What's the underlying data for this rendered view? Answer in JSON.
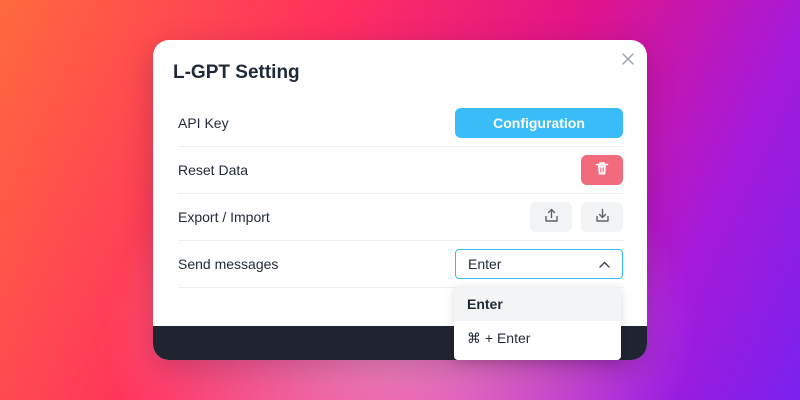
{
  "dialog": {
    "title": "L-GPT Setting",
    "close_icon": "close-icon"
  },
  "settings": {
    "api_key": {
      "label": "API Key",
      "button_label": "Configuration"
    },
    "reset_data": {
      "label": "Reset Data",
      "icon": "trash-icon"
    },
    "export_import": {
      "label": "Export / Import",
      "export_icon": "upload-icon",
      "import_icon": "download-icon"
    },
    "send_messages": {
      "label": "Send messages",
      "selected": "Enter",
      "icon": "chevron-up-icon"
    }
  },
  "dropdown": {
    "options": [
      "Enter",
      "⌘ + Enter"
    ],
    "active_index": 0
  },
  "colors": {
    "accent": "#38bdf8",
    "danger": "#f26b7c",
    "footer": "#1f2430"
  }
}
